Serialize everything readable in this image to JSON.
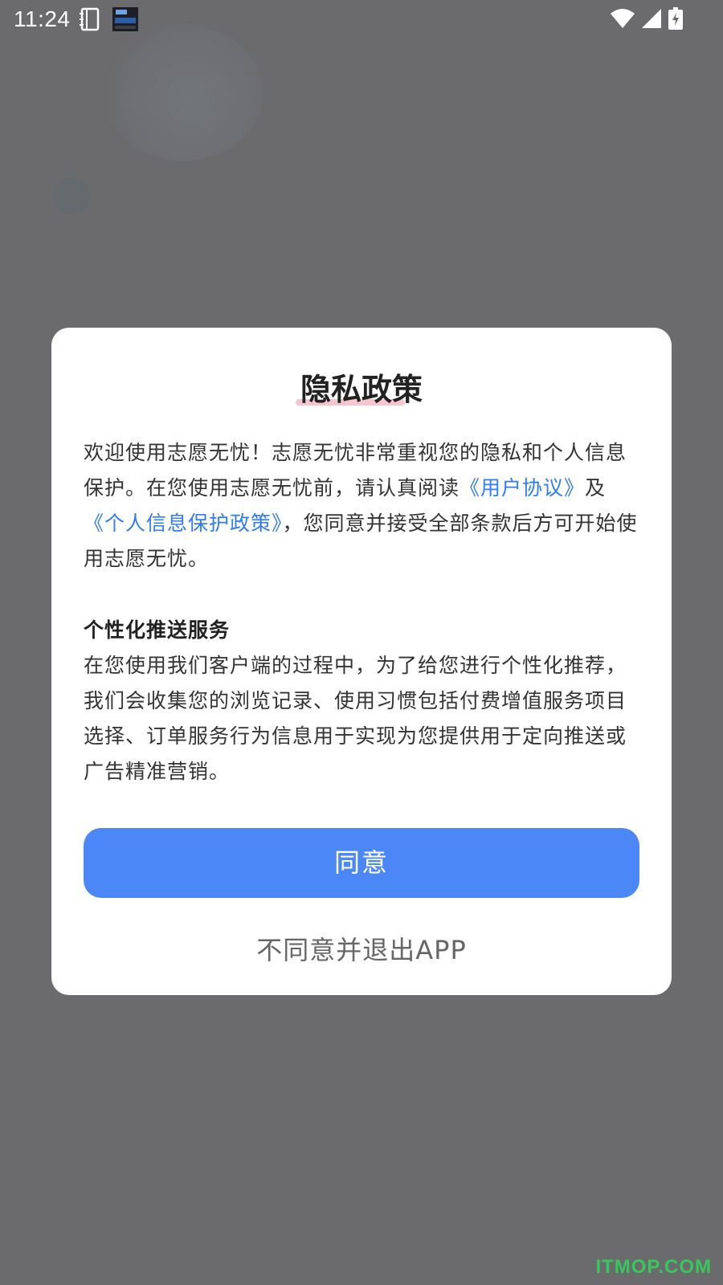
{
  "status_bar": {
    "time": "11:24",
    "icons": [
      "notebook-icon",
      "clock-widget-icon",
      "wifi-icon",
      "signal-icon",
      "battery-charging-icon"
    ]
  },
  "dialog": {
    "title": "隐私政策",
    "intro": {
      "before_link1": "欢迎使用志愿无忧！志愿无忧非常重视您的隐私和个人信息保护。在您使用志愿无忧前，请认真阅读",
      "link1": "《用户协议》",
      "between_links": "及",
      "link2": "《个人信息保护政策》",
      "after_link2": "，您同意并接受全部条款后方可开始使用志愿无忧。"
    },
    "section_heading": "个性化推送服务",
    "section_body": "在您使用我们客户端的过程中，为了给您进行个性化推荐，我们会收集您的浏览记录、使用习惯包括付费增值服务项目选择、订单服务行为信息用于实现为您提供用于定向推送或广告精准营销。",
    "agree_label": "同意",
    "disagree_label": "不同意并退出APP"
  },
  "watermark": "ITMOP.COM",
  "colors": {
    "backdrop": "#6b6b6d",
    "link": "#2f7cf6",
    "button": "#4b87f6",
    "title_underline": "#f5c6cf"
  }
}
